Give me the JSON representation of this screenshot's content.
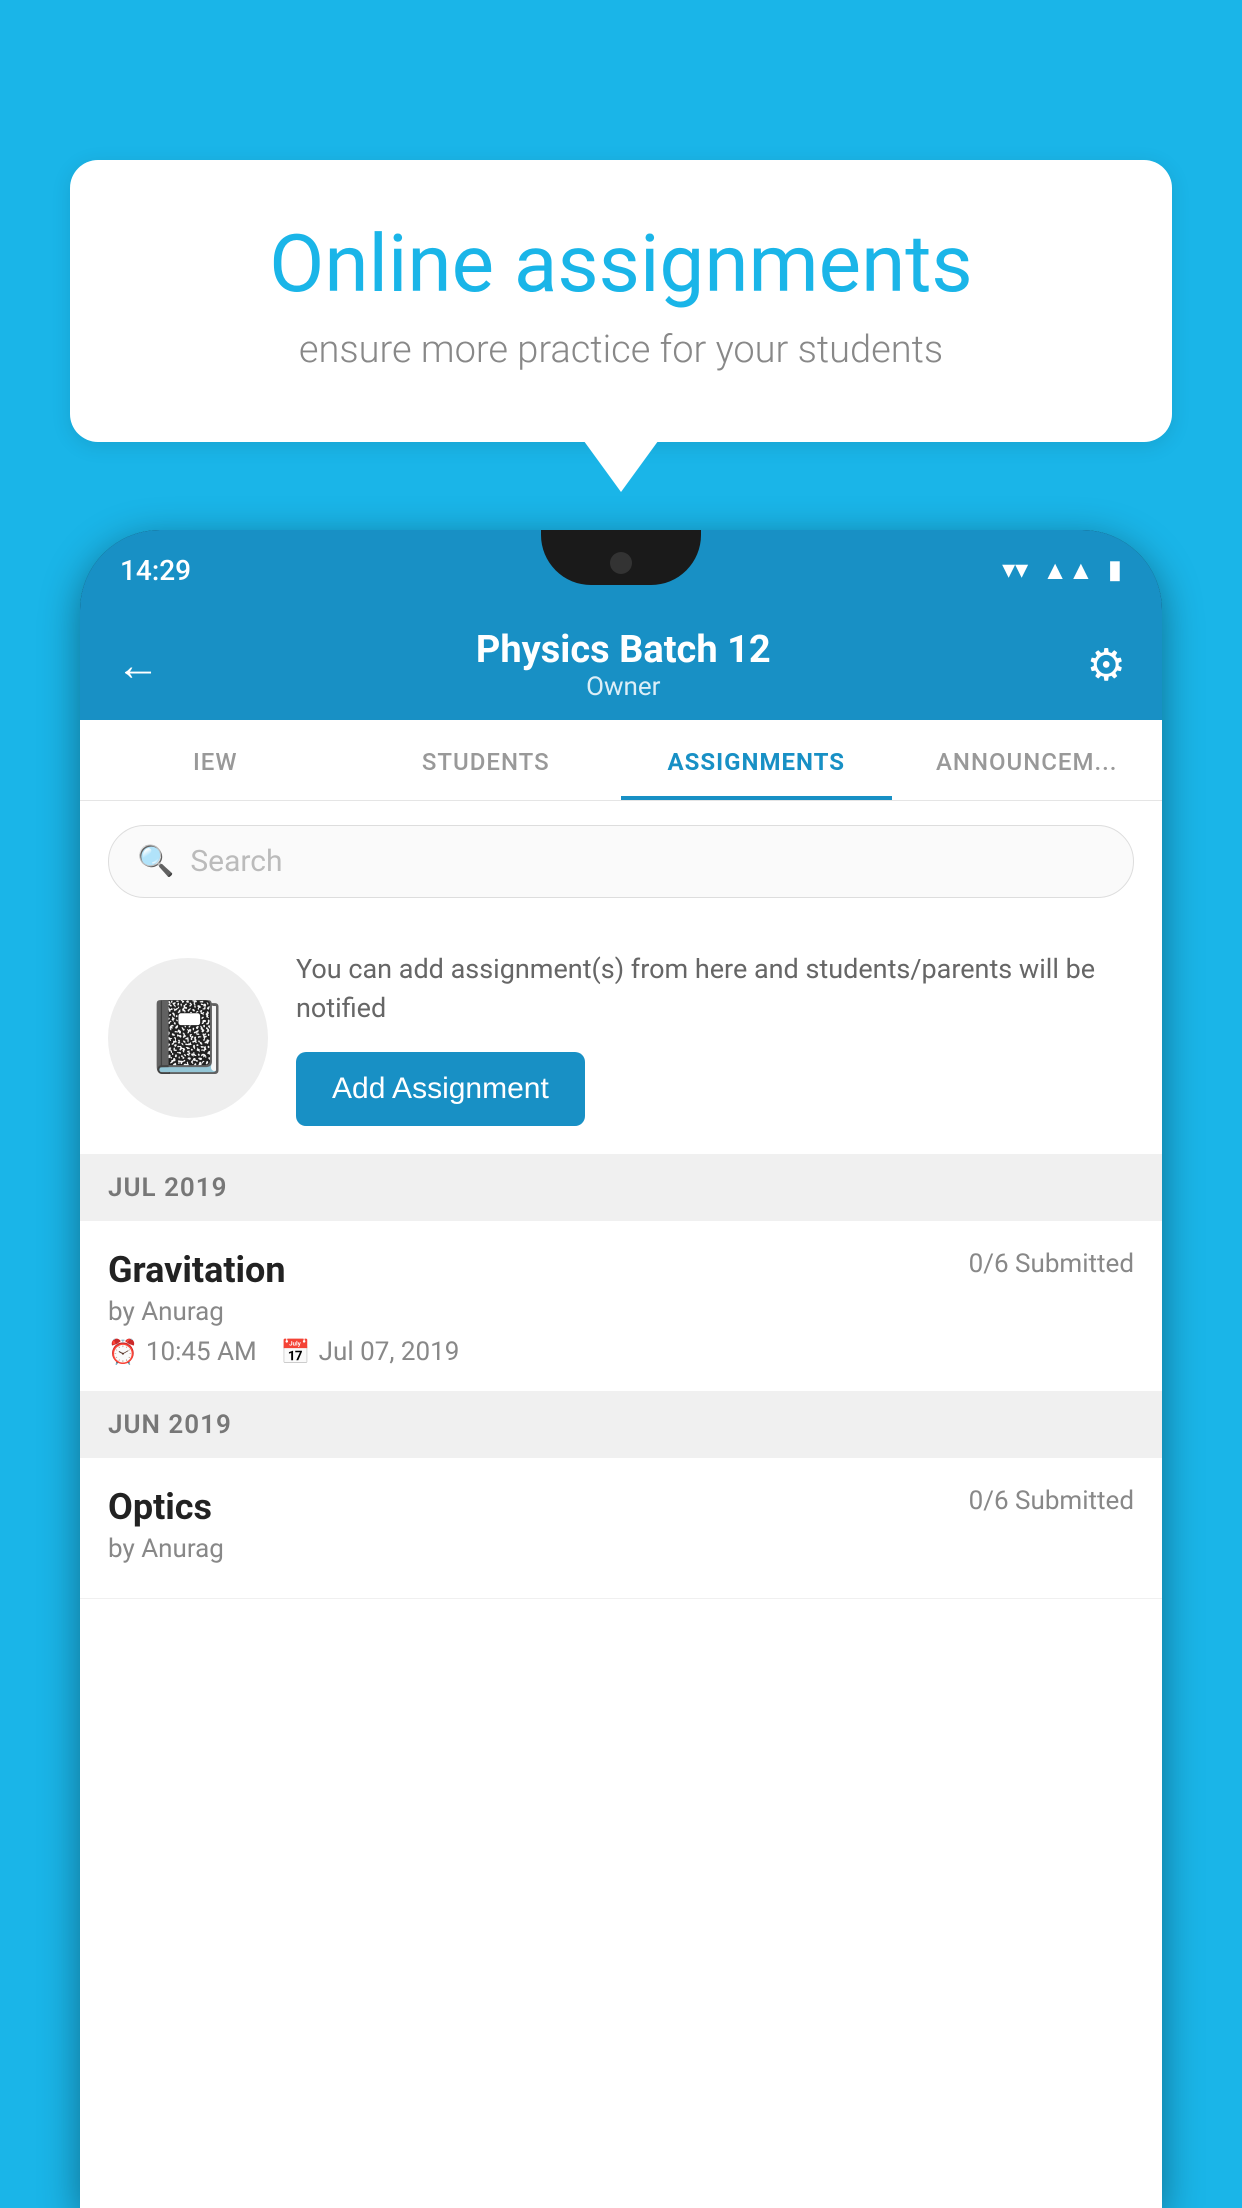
{
  "background_color": "#1ab5e8",
  "bubble": {
    "title": "Online assignments",
    "subtitle": "ensure more practice for your students"
  },
  "status_bar": {
    "time": "14:29",
    "icons": [
      "wifi",
      "signal",
      "battery"
    ]
  },
  "header": {
    "title": "Physics Batch 12",
    "subtitle": "Owner"
  },
  "tabs": [
    {
      "label": "IEW",
      "active": false
    },
    {
      "label": "STUDENTS",
      "active": false
    },
    {
      "label": "ASSIGNMENTS",
      "active": true
    },
    {
      "label": "ANNOUNCEM...",
      "active": false
    }
  ],
  "search": {
    "placeholder": "Search"
  },
  "promo": {
    "description": "You can add assignment(s) from here and students/parents will be notified",
    "button_label": "Add Assignment"
  },
  "sections": [
    {
      "month_label": "JUL 2019",
      "assignments": [
        {
          "name": "Gravitation",
          "submitted": "0/6 Submitted",
          "author": "by Anurag",
          "time": "10:45 AM",
          "date": "Jul 07, 2019"
        }
      ]
    },
    {
      "month_label": "JUN 2019",
      "assignments": [
        {
          "name": "Optics",
          "submitted": "0/6 Submitted",
          "author": "by Anurag",
          "time": "",
          "date": ""
        }
      ]
    }
  ]
}
